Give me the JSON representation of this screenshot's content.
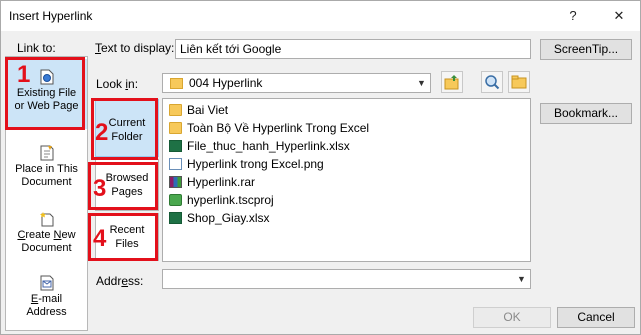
{
  "window": {
    "title": "Insert Hyperlink",
    "help_glyph": "?",
    "close_glyph": "✕"
  },
  "link_to": {
    "label": "Link to:",
    "items": [
      {
        "label_line1": "Existing File",
        "label_line2": "or Web Page",
        "icon": "web-page-icon"
      },
      {
        "label_line1": "Place in This",
        "label_line2": "Document",
        "icon": "document-place-icon"
      },
      {
        "label_line1": "Create New",
        "label_line2": "Document",
        "icon": "new-document-icon"
      },
      {
        "label_line1": "E-mail",
        "label_line2": "Address",
        "icon": "email-icon"
      }
    ]
  },
  "text_to_display": {
    "label": "Text to display:",
    "value": "Liên kết tới Google"
  },
  "screentip_button": "ScreenTip...",
  "look_in": {
    "label": "Look in:",
    "value": "004 Hyperlink"
  },
  "browse_tabs": [
    {
      "line1": "Current",
      "line2": "Folder"
    },
    {
      "line1": "Browsed",
      "line2": "Pages"
    },
    {
      "line1": "Recent",
      "line2": "Files"
    }
  ],
  "files": [
    {
      "name": "Bai Viet",
      "icon": "folder-icon"
    },
    {
      "name": "Toàn Bộ Về Hyperlink Trong Excel",
      "icon": "folder-icon"
    },
    {
      "name": "File_thuc_hanh_Hyperlink.xlsx",
      "icon": "excel-icon"
    },
    {
      "name": "Hyperlink trong Excel.png",
      "icon": "image-icon"
    },
    {
      "name": "Hyperlink.rar",
      "icon": "rar-icon"
    },
    {
      "name": "hyperlink.tscproj",
      "icon": "camtasia-icon"
    },
    {
      "name": "Shop_Giay.xlsx",
      "icon": "excel-icon"
    }
  ],
  "bookmark_button": "Bookmark...",
  "address": {
    "label": "Address:",
    "value": ""
  },
  "ok_button": "OK",
  "cancel_button": "Cancel",
  "annotations": [
    "1",
    "2",
    "3",
    "4"
  ],
  "colors": {
    "annotation": "#e3101b",
    "selected": "#cce4f7"
  }
}
